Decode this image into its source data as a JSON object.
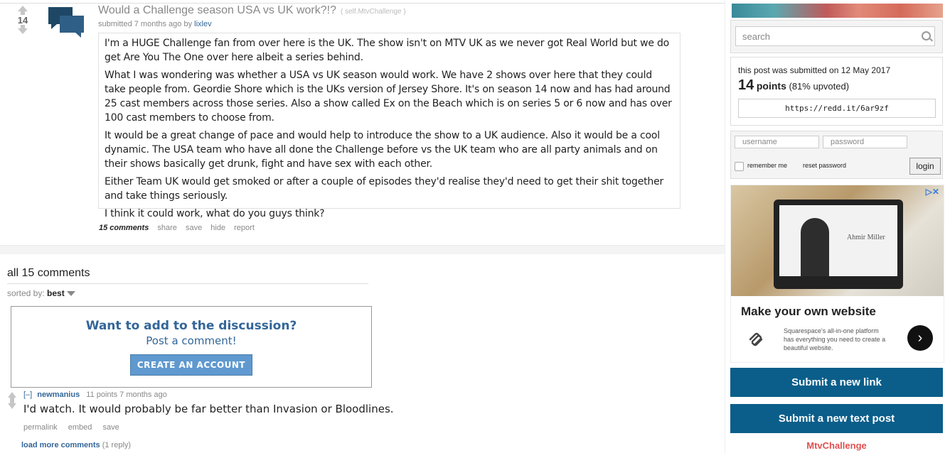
{
  "post": {
    "score": "14",
    "title": "Would a Challenge season USA vs UK work?!?",
    "domain": "( self.MtvChallenge )",
    "submitted": "submitted 7 months ago by",
    "author": "lixlev",
    "paragraphs": [
      "I'm a HUGE Challenge fan from over here is the UK. The show isn't on MTV UK as we never got Real World but we do get Are You The One over here albeit a series behind.",
      "What I was wondering was whether a USA vs UK season would work. We have 2 shows over here that they could take people from. Geordie Shore which is the UKs version of Jersey Shore. It's on season 14 now and has had around 25 cast members across those series. Also a show called Ex on the Beach which is on series 5 or 6 now and has over 100 cast members to choose from.",
      "It would be a great change of pace and would help to introduce the show to a UK audience. Also it would be a cool dynamic. The USA team who have all done the Challenge before vs the UK team who are all party animals and on their shows basically get drunk, fight and have sex with each other.",
      "Either Team UK would get smoked or after a couple of episodes they'd realise they'd need to get their shit together and take things seriously.",
      "I think it could work, what do you guys think?"
    ],
    "buttons": {
      "comments": "15 comments",
      "share": "share",
      "save": "save",
      "hide": "hide",
      "report": "report"
    }
  },
  "comments_section": {
    "title": "all 15 comments",
    "sorted_label": "sorted by:",
    "sorted_value": "best",
    "cta": {
      "headline": "Want to add to the discussion?",
      "subline": "Post a comment!",
      "button": "CREATE AN ACCOUNT"
    },
    "comment": {
      "toggle": "[–]",
      "author": "newmanius",
      "meta": "11 points 7 months ago",
      "body": "I'd watch. It would probably be far better than Invasion or Bloodlines.",
      "buttons": {
        "permalink": "permalink",
        "embed": "embed",
        "save": "save"
      }
    },
    "load_more": "load more comments",
    "load_more_count": "(1 reply)"
  },
  "sidebar": {
    "search_placeholder": "search",
    "submitted_text": "this post was submitted on 12 May 2017",
    "points": "14",
    "points_label": "points",
    "upvoted": "(81% upvoted)",
    "shortlink": "https://redd.it/6ar9zf",
    "login": {
      "username_placeholder": "username",
      "password_placeholder": "password",
      "remember": "remember me",
      "reset": "reset password",
      "button": "login"
    },
    "ad": {
      "screen_name": "Ahmir Miller",
      "headline": "Make your own website",
      "description": "Squarespace's all-in-one platform has everything you need to create a beautiful website."
    },
    "submit_link": "Submit a new link",
    "submit_text": "Submit a new text post",
    "subreddit": "MtvChallenge"
  }
}
